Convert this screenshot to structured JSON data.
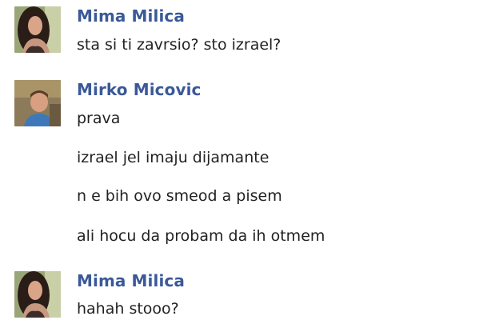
{
  "conversation": {
    "groups": [
      {
        "sender": "Mima Milica",
        "avatar_icon": "profile-photo-woman-icon",
        "messages": [
          "sta si ti zavrsio? sto izrael?"
        ]
      },
      {
        "sender": "Mirko Micovic",
        "avatar_icon": "profile-photo-boy-icon",
        "messages": [
          "prava",
          "izrael jel imaju dijamante",
          "n e bih ovo smeod a pisem",
          "ali hocu da probam da ih otmem"
        ]
      },
      {
        "sender": "Mima Milica",
        "avatar_icon": "profile-photo-woman-icon",
        "messages": [
          "hahah stooo?"
        ]
      }
    ]
  },
  "colors": {
    "sender_name": "#3b5998",
    "message_text": "#222222",
    "background": "#ffffff"
  }
}
